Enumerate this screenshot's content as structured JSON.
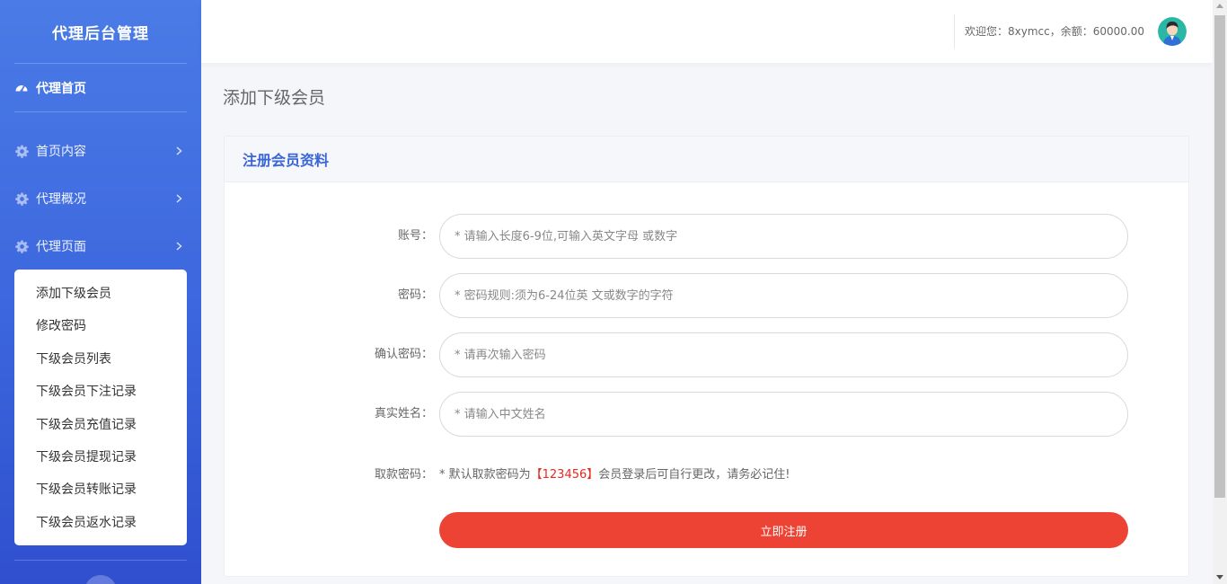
{
  "sidebar": {
    "brand": "代理后台管理",
    "home": {
      "label": "代理首页",
      "icon": "dashboard-icon"
    },
    "groups": [
      {
        "label": "首页内容",
        "icon": "gear-icon"
      },
      {
        "label": "代理概况",
        "icon": "gear-icon"
      },
      {
        "label": "代理页面",
        "icon": "gear-icon"
      }
    ],
    "submenu": [
      "添加下级会员",
      "修改密码",
      "下级会员列表",
      "下级会员下注记录",
      "下级会员充值记录",
      "下级会员提现记录",
      "下级会员转账记录",
      "下级会员返水记录"
    ]
  },
  "header": {
    "welcome": "欢迎您：8xymcc，余额：60000.00"
  },
  "page": {
    "title": "添加下级会员"
  },
  "card": {
    "title": "注册会员资料",
    "fields": [
      {
        "label": "账号：",
        "placeholder": "* 请输入长度6-9位,可输入英文字母 或数字"
      },
      {
        "label": "密码：",
        "placeholder": "* 密码规则:须为6-24位英 文或数字的字符"
      },
      {
        "label": "确认密码：",
        "placeholder": "* 请再次输入密码"
      },
      {
        "label": "真实姓名：",
        "placeholder": "* 请输入中文姓名"
      }
    ],
    "withdraw": {
      "label": "取款密码：",
      "note_prefix": "* 默认取款密码为",
      "note_highlight": "【123456】",
      "note_suffix": "会员登录后可自行更改，请务必记住!"
    },
    "submit_label": "立即注册"
  },
  "colors": {
    "accent": "#3a66d8",
    "submit": "#ec4335",
    "highlight": "#e52a1f"
  }
}
